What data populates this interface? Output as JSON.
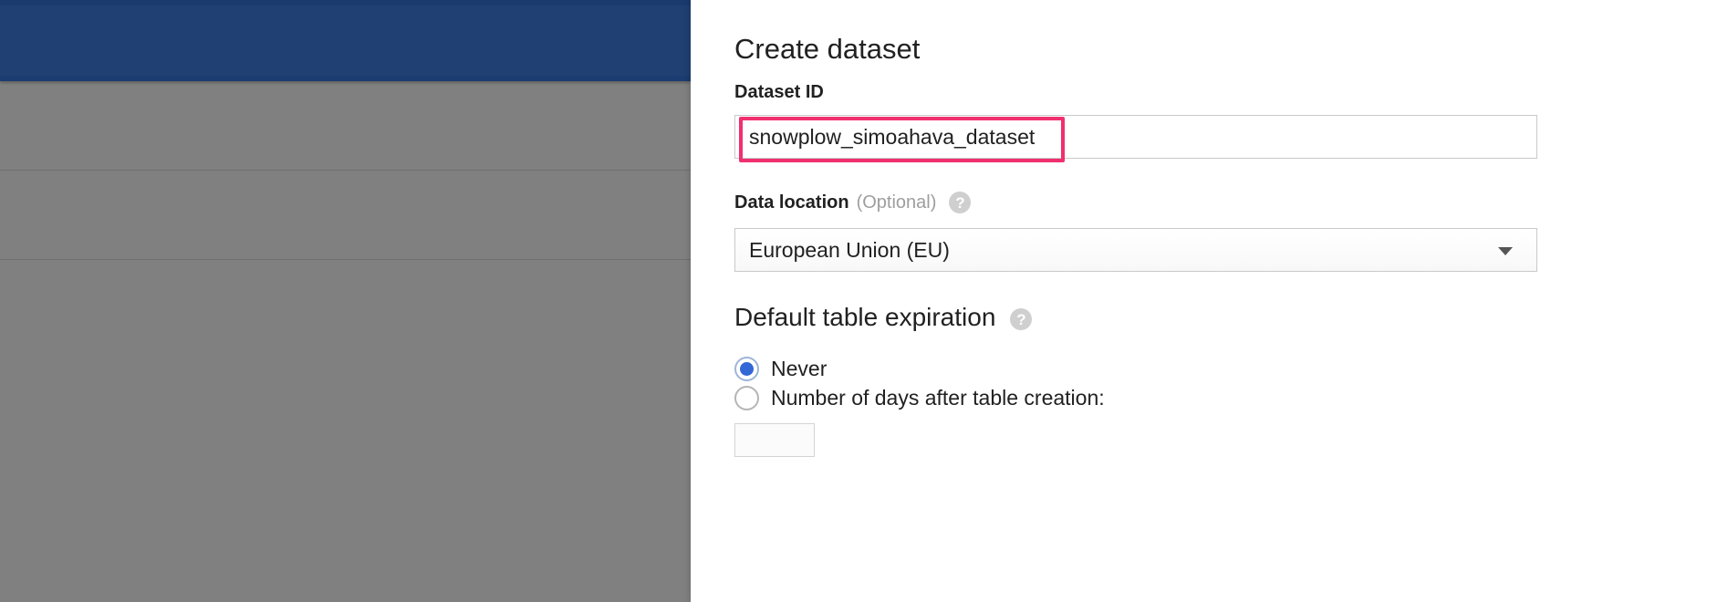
{
  "dialog": {
    "title": "Create dataset"
  },
  "dataset_id": {
    "label": "Dataset ID",
    "value": "snowplow_simoahava_dataset",
    "highlight_color": "#f0306f"
  },
  "data_location": {
    "label": "Data location",
    "optional_text": "(Optional)",
    "help_icon": "question-mark-circle-icon",
    "selected": "European Union (EU)"
  },
  "table_expiration": {
    "heading": "Default table expiration",
    "help_icon": "question-mark-circle-icon",
    "options": [
      {
        "label": "Never",
        "checked": true
      },
      {
        "label": "Number of days after table creation:",
        "checked": false
      }
    ],
    "days_value": ""
  },
  "colors": {
    "header_blue": "#203f72",
    "overlay_gray": "#808080",
    "radio_accent": "#3367d6"
  }
}
